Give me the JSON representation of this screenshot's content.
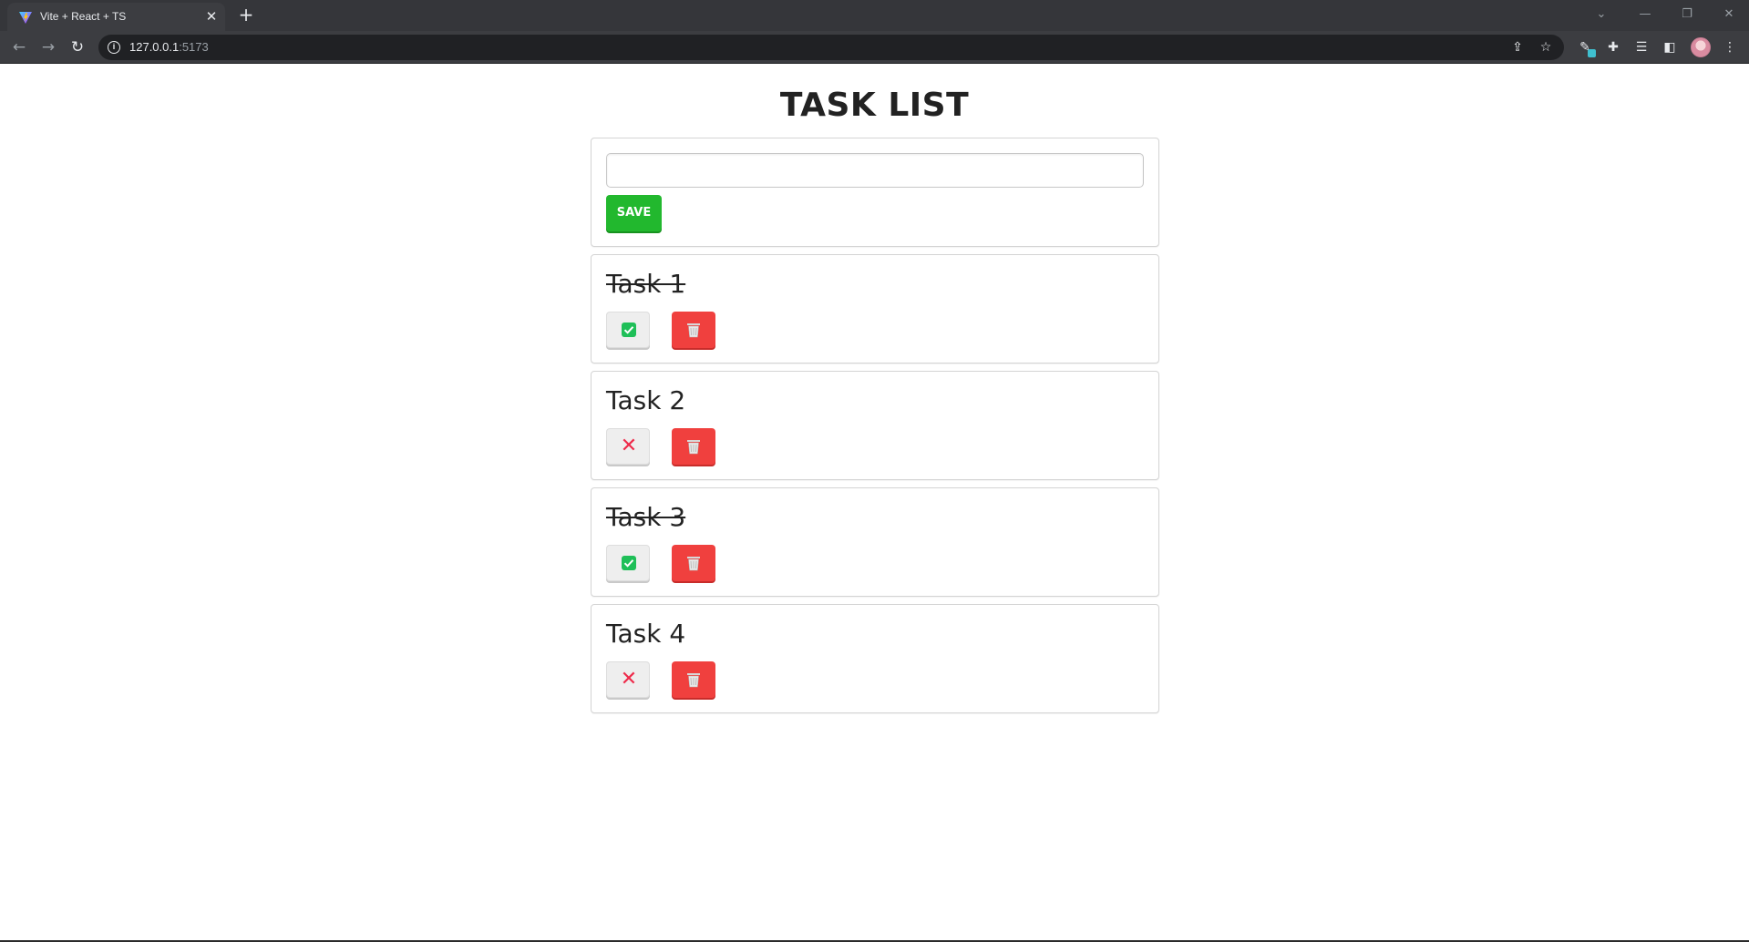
{
  "browser": {
    "tab_title": "Vite + React + TS",
    "tab_close": "✕",
    "new_tab": "+",
    "url_host": "127.0.0.1",
    "url_port": ":5173",
    "back": "←",
    "forward": "→",
    "reload": "↻",
    "window_controls": {
      "minimize": "—",
      "restore": "❐",
      "close": "✕",
      "tab_search": "⌄"
    },
    "info_glyph": "i"
  },
  "page": {
    "title": "TASK LIST",
    "input": {
      "value": "",
      "placeholder": ""
    },
    "save_label": "SAVE"
  },
  "tasks": [
    {
      "text": "Task 1",
      "completed": true
    },
    {
      "text": "Task 2",
      "completed": false
    },
    {
      "text": "Task 3",
      "completed": true
    },
    {
      "text": "Task 4",
      "completed": false
    }
  ],
  "icons": {
    "completed": "check-icon",
    "not_completed": "cross-icon",
    "delete": "trash-icon",
    "cross_glyph": "✕"
  },
  "colors": {
    "save": "#22b82e",
    "delete": "#f0403e",
    "check": "#1fbf58",
    "cross": "#ee2a4a"
  }
}
